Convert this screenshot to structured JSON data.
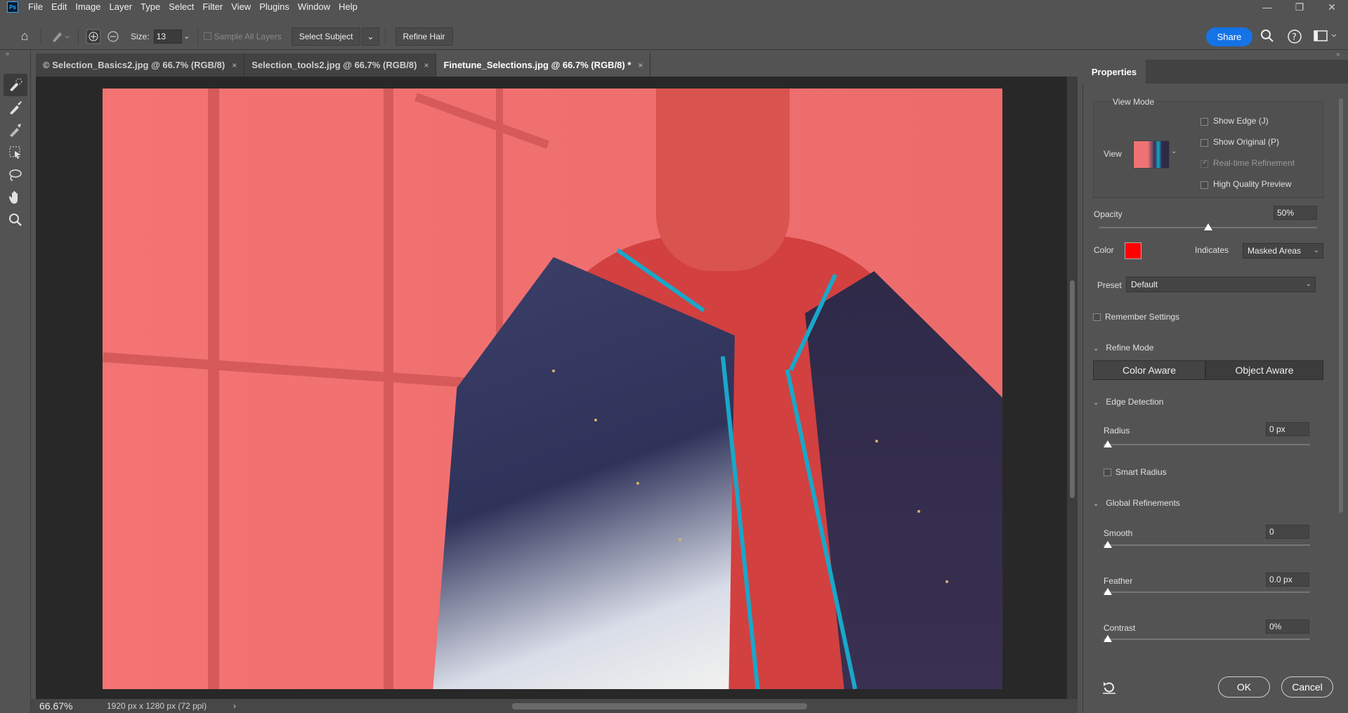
{
  "app": {
    "logo": "Ps"
  },
  "menu": [
    "File",
    "Edit",
    "Image",
    "Layer",
    "Type",
    "Select",
    "Filter",
    "View",
    "Plugins",
    "Window",
    "Help"
  ],
  "window_controls": {
    "minimize": "—",
    "restore": "❐",
    "close": "✕"
  },
  "options_bar": {
    "size_label": "Size:",
    "size_value": "13",
    "sample_all_layers": "Sample All Layers",
    "select_subject": "Select Subject",
    "refine_hair": "Refine Hair",
    "share": "Share"
  },
  "tabs": [
    {
      "label": "© Selection_Basics2.jpg @ 66.7% (RGB/8)",
      "active": false
    },
    {
      "label": "Selection_tools2.jpg @ 66.7% (RGB/8)",
      "active": false
    },
    {
      "label": "Finetune_Selections.jpg @ 66.7% (RGB/8) *",
      "active": true
    }
  ],
  "tab_close": "×",
  "status": {
    "zoom": "66.67%",
    "doc_info": "1920 px x 1280 px (72 ppi)",
    "arrow": "›"
  },
  "properties": {
    "tab": "Properties",
    "view_mode": {
      "title": "View Mode",
      "view_label": "View",
      "show_edge": "Show Edge (J)",
      "show_original": "Show Original (P)",
      "realtime_refinement": "Real-time Refinement",
      "high_quality_preview": "High Quality Preview"
    },
    "opacity": {
      "label": "Opacity",
      "value": "50%",
      "level": 0.5
    },
    "color_label": "Color",
    "indicates": {
      "label": "Indicates",
      "value": "Masked Areas"
    },
    "preset": {
      "label": "Preset",
      "value": "Default"
    },
    "remember_settings": "Remember Settings",
    "refine_mode": {
      "title": "Refine Mode",
      "color_aware": "Color Aware",
      "object_aware": "Object Aware"
    },
    "edge_detection": {
      "title": "Edge Detection",
      "radius_label": "Radius",
      "radius_value": "0 px",
      "smart_radius": "Smart Radius"
    },
    "global_refinements": {
      "title": "Global Refinements",
      "smooth_label": "Smooth",
      "smooth_value": "0",
      "feather_label": "Feather",
      "feather_value": "0.0 px",
      "contrast_label": "Contrast",
      "contrast_value": "0%"
    },
    "ok": "OK",
    "cancel": "Cancel"
  },
  "colors": {
    "accent": "#1473e6",
    "overlay": "#ff0000",
    "ui_bg": "#535353",
    "canvas_bg": "#282828"
  }
}
